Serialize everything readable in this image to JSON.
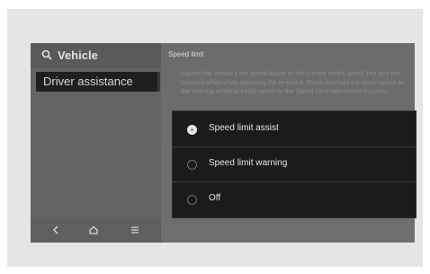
{
  "header": {
    "title": "Vehicle",
    "search_icon": "search-icon"
  },
  "sidebar": {
    "items": [
      {
        "label": "Driver assistance",
        "selected": true
      }
    ]
  },
  "bottom_bar": {
    "icons": [
      "back-icon",
      "home-icon",
      "menu-icon"
    ]
  },
  "detail": {
    "title": "Speed limit",
    "description": "Adjusts the vehicle's set speed based on the current road's speed limit and the selected offset when operating the re-switch. Press and hold the mode switch on the steering wheel to easily switch to the Speed Limit Information Function."
  },
  "popup": {
    "options": [
      {
        "label": "Speed limit assist",
        "selected": true
      },
      {
        "label": "Speed limit warning",
        "selected": false
      },
      {
        "label": "Off",
        "selected": false
      }
    ]
  },
  "colors": {
    "popup_bg": "#1b1b1b",
    "screen_bg": "#6a6a6a",
    "selected_item_bg": "#1f1f1f"
  }
}
